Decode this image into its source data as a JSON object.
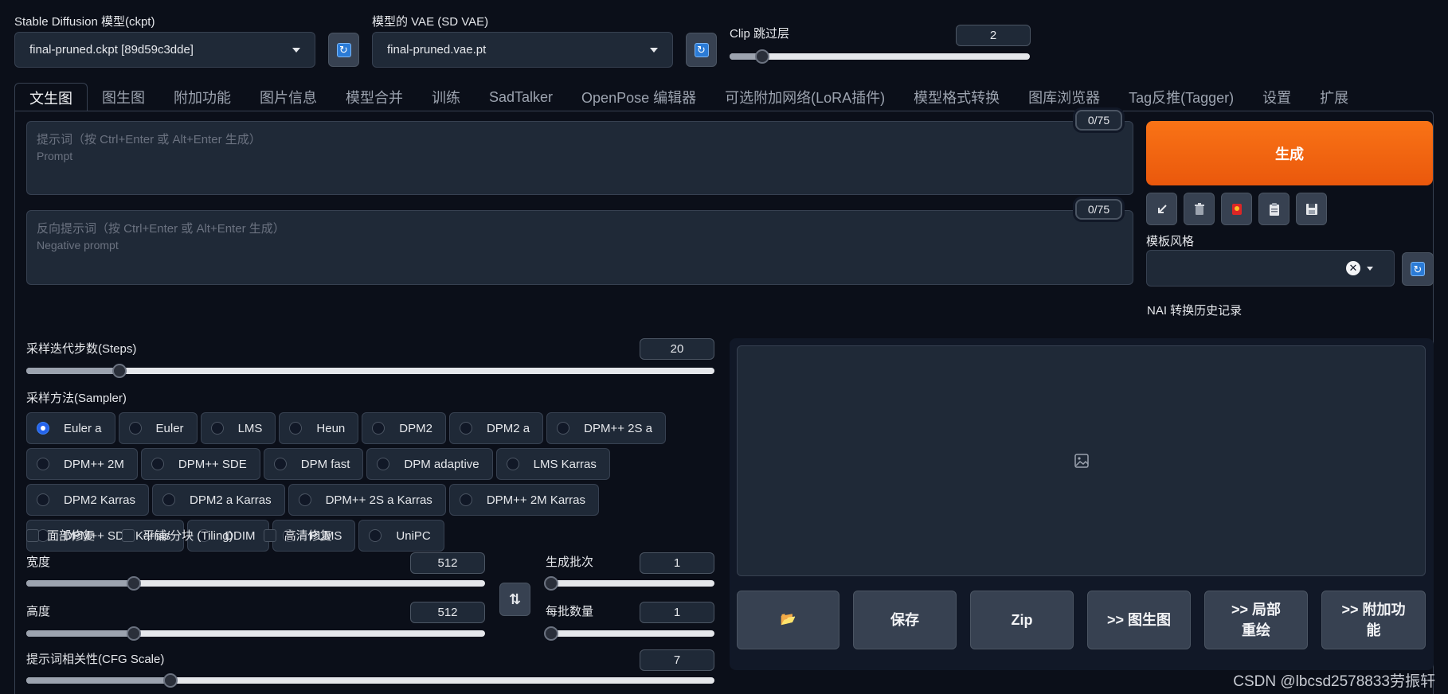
{
  "top": {
    "ckpt_label": "Stable Diffusion 模型(ckpt)",
    "ckpt_value": "final-pruned.ckpt [89d59c3dde]",
    "vae_label": "模型的 VAE (SD VAE)",
    "vae_value": "final-pruned.vae.pt",
    "clip_label": "Clip 跳过层",
    "clip_value": "2",
    "clip_fraction": 0.11
  },
  "tabs": [
    {
      "label": "文生图",
      "active": true
    },
    {
      "label": "图生图"
    },
    {
      "label": "附加功能"
    },
    {
      "label": "图片信息"
    },
    {
      "label": "模型合并"
    },
    {
      "label": "训练"
    },
    {
      "label": "SadTalker"
    },
    {
      "label": "OpenPose 编辑器"
    },
    {
      "label": "可选附加网络(LoRA插件)"
    },
    {
      "label": "模型格式转换"
    },
    {
      "label": "图库浏览器"
    },
    {
      "label": "Tag反推(Tagger)"
    },
    {
      "label": "设置"
    },
    {
      "label": "扩展"
    }
  ],
  "prompt": {
    "placeholder_line1": "提示词（按 Ctrl+Enter 或 Alt+Enter 生成）",
    "placeholder_line2": "Prompt",
    "counter": "0/75"
  },
  "negative": {
    "placeholder_line1": "反向提示词（按 Ctrl+Enter 或 Alt+Enter 生成）",
    "placeholder_line2": "Negative prompt",
    "counter": "0/75"
  },
  "generate_label": "生成",
  "tool_icons": [
    "arrow-icon",
    "trash-icon",
    "card-icon",
    "clipboard-icon",
    "save-icon"
  ],
  "style": {
    "label": "模板风格",
    "history_label": "NAI 转换历史记录"
  },
  "steps": {
    "label": "采样迭代步数(Steps)",
    "value": "20",
    "fraction": 0.135
  },
  "sampler": {
    "label": "采样方法(Sampler)",
    "options": [
      "Euler a",
      "Euler",
      "LMS",
      "Heun",
      "DPM2",
      "DPM2 a",
      "DPM++ 2S a",
      "DPM++ 2M",
      "DPM++ SDE",
      "DPM fast",
      "DPM adaptive",
      "LMS Karras",
      "DPM2 Karras",
      "DPM2 a Karras",
      "DPM++ 2S a Karras",
      "DPM++ 2M Karras",
      "DPM++ SDE Karras",
      "DDIM",
      "PLMS",
      "UniPC"
    ],
    "selected": "Euler a"
  },
  "checks": {
    "face": "面部修复",
    "tiling": "平铺/分块 (Tiling)",
    "hires": "高清修复"
  },
  "width": {
    "label": "宽度",
    "value": "512",
    "fraction": 0.235
  },
  "height": {
    "label": "高度",
    "value": "512",
    "fraction": 0.235
  },
  "batch_count": {
    "label": "生成批次",
    "value": "1",
    "fraction": 0.0
  },
  "batch_size": {
    "label": "每批数量",
    "value": "1",
    "fraction": 0.0
  },
  "cfg": {
    "label": "提示词相关性(CFG Scale)",
    "value": "7",
    "fraction": 0.21
  },
  "actions": {
    "folder_icon": "📂",
    "save": "保存",
    "zip": "Zip",
    "to_img2img": ">> 图生图",
    "to_inpaint": ">> 局部重绘",
    "to_extras": ">> 附加功能"
  },
  "watermark": "CSDN @lbcsd2578833劳振轩"
}
